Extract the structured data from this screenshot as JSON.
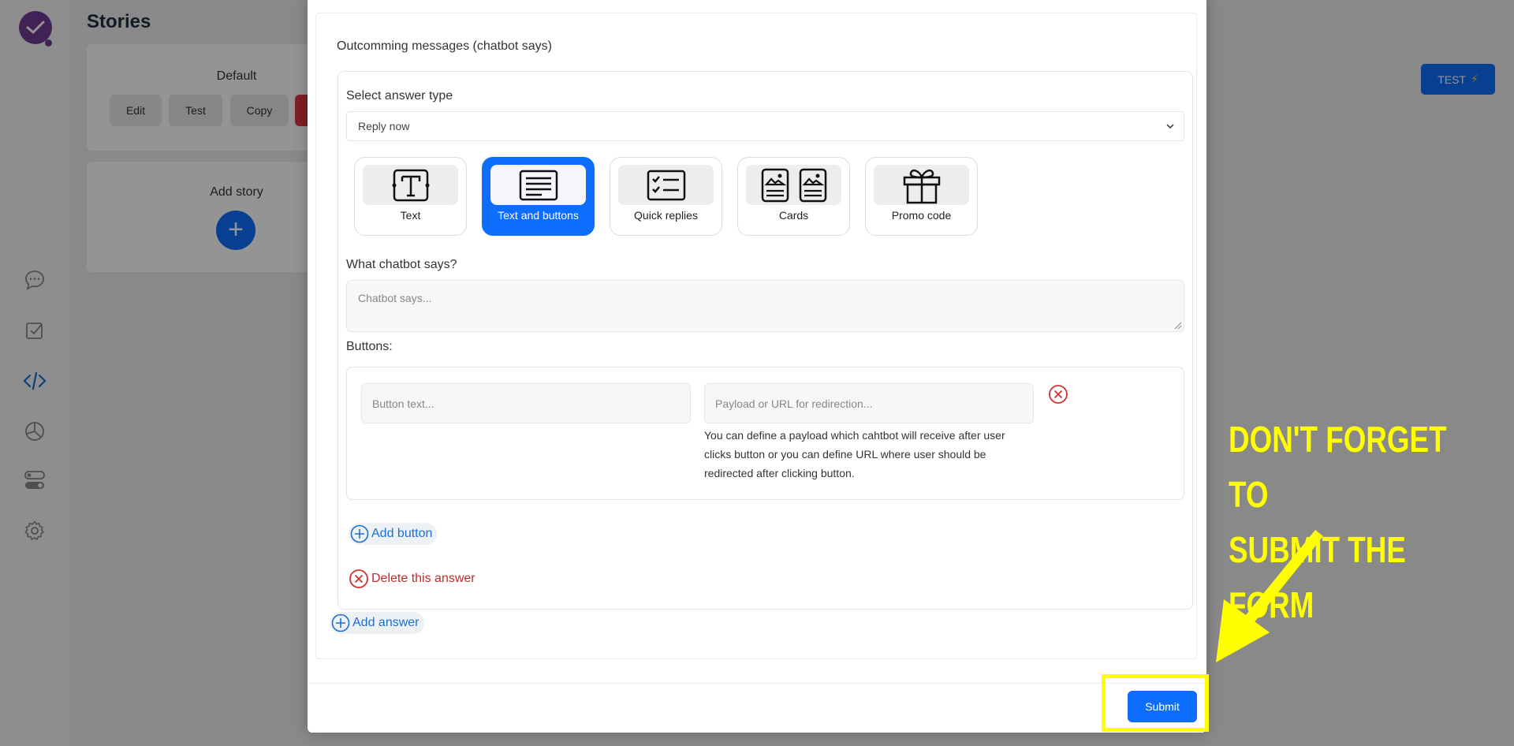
{
  "background": {
    "page_title": "Stories",
    "default_story": {
      "name": "Default",
      "buttons": [
        "Edit",
        "Test",
        "Copy",
        ""
      ]
    },
    "add_story_label": "Add story",
    "add_story_symbol": "+",
    "test_button": {
      "label": "TEST",
      "icon": "⚡"
    },
    "sidebar_icons": [
      "chat-bubble-icon",
      "checkbox-icon",
      "code-icon",
      "pie-chart-icon",
      "toggle-icon",
      "gear-icon"
    ]
  },
  "modal": {
    "section_title": "Outcomming messages (chatbot says)",
    "answer": {
      "select_label": "Select answer type",
      "select_value": "Reply now",
      "types": [
        {
          "label": "Text",
          "icon": "text-format-icon",
          "active": false
        },
        {
          "label": "Text and buttons",
          "icon": "text-lines-icon",
          "active": true
        },
        {
          "label": "Quick replies",
          "icon": "checklist-icon",
          "active": false
        },
        {
          "label": "Cards",
          "icon": "cards-icon",
          "active": false
        },
        {
          "label": "Promo code",
          "icon": "gift-icon",
          "active": false
        }
      ],
      "chatbot_says_label": "What chatbot says?",
      "chatbot_says_placeholder": "Chatbot says...",
      "buttons_label": "Buttons:",
      "button_text_placeholder": "Button text...",
      "payload_placeholder": "Payload or URL for redirection...",
      "payload_help": "You can define a payload which cahtbot will receive after user clicks button or you can define URL where user should be redirected after clicking button.",
      "add_button_label": "Add button",
      "delete_answer_label": "Delete this answer"
    },
    "add_answer_label": "Add answer",
    "submit_label": "Submit"
  },
  "annotation": {
    "line1": "DON'T FORGET TO",
    "line2": "SUBMIT THE FORM",
    "color": "#ffff00"
  },
  "colors": {
    "primary": "#0d6efd",
    "danger": "#dc3545",
    "highlight": "#ffff00"
  }
}
